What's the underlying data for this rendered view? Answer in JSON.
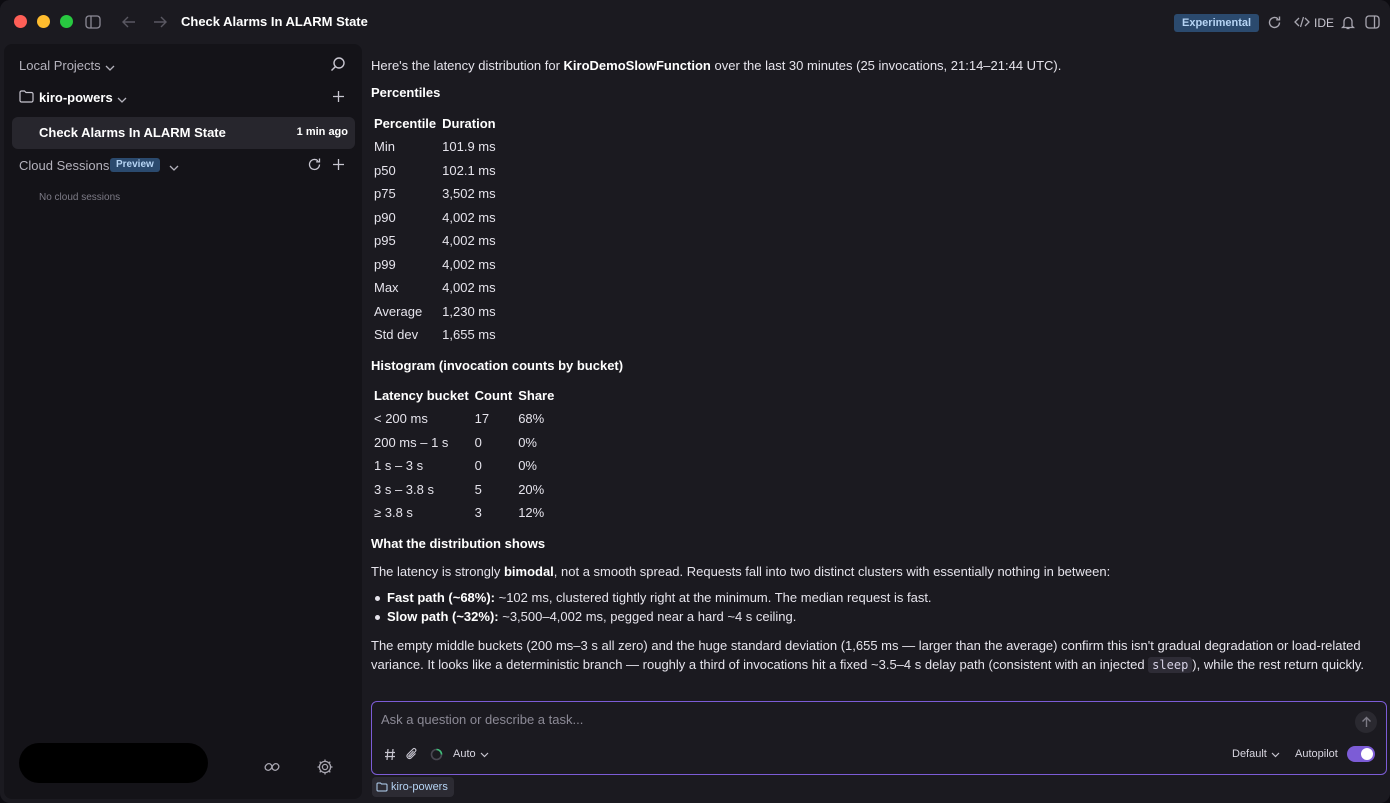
{
  "window": {
    "title": "Check Alarms In ALARM State",
    "experimental_badge": "Experimental",
    "ide_label": "IDE"
  },
  "sidebar": {
    "local_projects_label": "Local Projects",
    "project_name": "kiro-powers",
    "session_title": "Check Alarms In ALARM State",
    "session_time": "1 min ago",
    "cloud_sessions_label": "Cloud Sessions",
    "preview_badge": "Preview",
    "no_cloud_sessions": "No cloud sessions"
  },
  "chat": {
    "intro_prefix": "Here's the latency distribution for ",
    "intro_function": "KiroDemoSlowFunction",
    "intro_suffix": " over the last 30 minutes (25 invocations, 21:14–21:44 UTC).",
    "percentiles_heading": "Percentiles",
    "percentiles_table": {
      "headers": [
        "Percentile",
        "Duration"
      ],
      "rows": [
        [
          "Min",
          "101.9 ms"
        ],
        [
          "p50",
          "102.1 ms"
        ],
        [
          "p75",
          "3,502 ms"
        ],
        [
          "p90",
          "4,002 ms"
        ],
        [
          "p95",
          "4,002 ms"
        ],
        [
          "p99",
          "4,002 ms"
        ],
        [
          "Max",
          "4,002 ms"
        ],
        [
          "Average",
          "1,230 ms"
        ],
        [
          "Std dev",
          "1,655 ms"
        ]
      ]
    },
    "histogram_heading": "Histogram (invocation counts by bucket)",
    "histogram_table": {
      "headers": [
        "Latency bucket",
        "Count",
        "Share"
      ],
      "rows": [
        [
          "< 200 ms",
          "17",
          "68%"
        ],
        [
          "200 ms – 1 s",
          "0",
          "0%"
        ],
        [
          "1 s – 3 s",
          "0",
          "0%"
        ],
        [
          "3 s – 3.8 s",
          "5",
          "20%"
        ],
        [
          "≥ 3.8 s",
          "3",
          "12%"
        ]
      ]
    },
    "distribution_heading": "What the distribution shows",
    "dist_para_prefix": "The latency is strongly ",
    "dist_para_bold": "bimodal",
    "dist_para_suffix": ", not a smooth spread. Requests fall into two distinct clusters with essentially nothing in between:",
    "bullets": [
      {
        "bold": "Fast path (~68%):",
        "text": " ~102 ms, clustered tightly right at the minimum. The median request is fast."
      },
      {
        "bold": "Slow path (~32%):",
        "text": " ~3,500–4,002 ms, pegged near a hard ~4 s ceiling."
      }
    ],
    "closing_prefix": "The empty middle buckets (200 ms–3 s all zero) and the huge standard deviation (1,655 ms — larger than the average) confirm this isn't gradual degradation or load-related variance. It looks like a deterministic branch — roughly a third of invocations hit a fixed ~3.5–4 s delay path (consistent with an injected ",
    "closing_code": "sleep",
    "closing_suffix": "), while the rest return quickly."
  },
  "input": {
    "placeholder": "Ask a question or describe a task...",
    "model_label": "Auto",
    "default_label": "Default",
    "autopilot_label": "Autopilot",
    "autopilot_on": true,
    "context_chip": "kiro-powers"
  },
  "colors": {
    "accent": "#7c5cd6",
    "badge_bg": "#2b4a6e",
    "badge_text": "#b6d4f4"
  }
}
